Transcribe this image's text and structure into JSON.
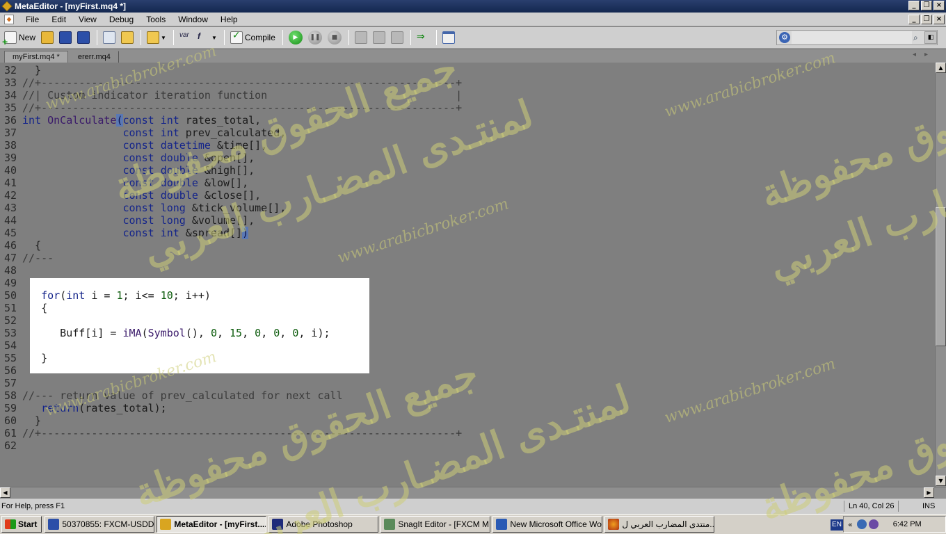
{
  "window": {
    "title": "MetaEditor - [myFirst.mq4 *]"
  },
  "menu": [
    "File",
    "Edit",
    "View",
    "Debug",
    "Tools",
    "Window",
    "Help"
  ],
  "toolbar": {
    "new_label": "New",
    "compile_label": "Compile",
    "var_label": "var",
    "fx_label": "f"
  },
  "tabs": [
    {
      "label": "myFirst.mq4 *",
      "active": true
    },
    {
      "label": "ererr.mq4",
      "active": false
    }
  ],
  "code_lines": [
    {
      "n": "32",
      "html": "  }"
    },
    {
      "n": "33",
      "html": "<span class=\"cmt\">//+------------------------------------------------------------------+</span>"
    },
    {
      "n": "34",
      "html": "<span class=\"cmt\">//| Custom indicator iteration function                              |</span>"
    },
    {
      "n": "35",
      "html": "<span class=\"cmt\">//+------------------------------------------------------------------+</span>"
    },
    {
      "n": "36",
      "html": "<span class=\"kw\">int</span> <span class=\"fn\">OnCalculate</span><span class=\"hl\">(</span><span class=\"kw\">const</span> <span class=\"kw\">int</span> rates_total,"
    },
    {
      "n": "37",
      "html": "                <span class=\"kw\">const</span> <span class=\"kw\">int</span> prev_calculated,"
    },
    {
      "n": "38",
      "html": "                <span class=\"kw\">const</span> <span class=\"kw\">datetime</span> &amp;time[],"
    },
    {
      "n": "39",
      "html": "                <span class=\"kw\">const</span> <span class=\"kw\">double</span> &amp;open[],"
    },
    {
      "n": "40",
      "html": "                <span class=\"kw\">const</span> <span class=\"kw\">double</span> &amp;high[],"
    },
    {
      "n": "41",
      "html": "                <span class=\"kw\">const</span> <span class=\"kw\">double</span> &amp;low[],"
    },
    {
      "n": "42",
      "html": "                <span class=\"kw\">const</span> <span class=\"kw\">double</span> &amp;close[],"
    },
    {
      "n": "43",
      "html": "                <span class=\"kw\">const</span> <span class=\"kw\">long</span> &amp;tick_volume[],"
    },
    {
      "n": "44",
      "html": "                <span class=\"kw\">const</span> <span class=\"kw\">long</span> &amp;volume[],"
    },
    {
      "n": "45",
      "html": "                <span class=\"kw\">const</span> <span class=\"kw\">int</span> &amp;spread[]<span class=\"hl\">)</span>"
    },
    {
      "n": "46",
      "html": "  {"
    },
    {
      "n": "47",
      "html": "<span class=\"cmt\">//---</span>"
    },
    {
      "n": "48",
      "html": ""
    },
    {
      "n": "49",
      "html": ""
    },
    {
      "n": "50",
      "html": "   <span class=\"kw\">for</span>(<span class=\"kw\">int</span> i = <span class=\"num\">1</span>; i&lt;= <span class=\"num\">10</span>; i++)"
    },
    {
      "n": "51",
      "html": "   {"
    },
    {
      "n": "52",
      "html": ""
    },
    {
      "n": "53",
      "html": "      Buff[i] = <span class=\"fn\">iMA</span>(<span class=\"fn\">Symbol</span>(), <span class=\"num\">0</span>, <span class=\"num\">15</span>, <span class=\"num\">0</span>, <span class=\"num\">0</span>, <span class=\"num\">0</span>, i);"
    },
    {
      "n": "54",
      "html": ""
    },
    {
      "n": "55",
      "html": "   }"
    },
    {
      "n": "56",
      "html": ""
    },
    {
      "n": "57",
      "html": ""
    },
    {
      "n": "58",
      "html": "<span class=\"cmt\">//--- return value of prev_calculated for next call</span>"
    },
    {
      "n": "59",
      "html": "   <span class=\"kw\">return</span>(rates_total);"
    },
    {
      "n": "60",
      "html": "  }"
    },
    {
      "n": "61",
      "html": "<span class=\"cmt\">//+------------------------------------------------------------------+</span>"
    },
    {
      "n": "62",
      "html": ""
    }
  ],
  "status": {
    "help": "For Help, press F1",
    "position": "Ln 40, Col 26",
    "mode": "INS"
  },
  "taskbar": {
    "start_label": "Start",
    "tasks": [
      {
        "label": "50370855: FXCM-USDDe...",
        "icon": "ti-mt",
        "active": false
      },
      {
        "label": "MetaEditor - [myFirst....",
        "icon": "ti-me",
        "active": true
      },
      {
        "label": "Adobe Photoshop",
        "icon": "ti-ps",
        "active": false
      },
      {
        "label": "SnagIt Editor - [FXCM M...",
        "icon": "ti-sn",
        "active": false
      },
      {
        "label": "New Microsoft Office Wo...",
        "icon": "ti-wd",
        "active": false
      },
      {
        "label": "منتدى المضارب العربي ل...",
        "icon": "ti-ff",
        "active": false
      }
    ],
    "lang": "EN",
    "clock": "6:42 PM"
  },
  "watermark": {
    "site": "www.arabicbroker.com",
    "line1": "جميع الحقوق محفوظة",
    "line2": "لمنتـدى المضـارب العربي"
  }
}
